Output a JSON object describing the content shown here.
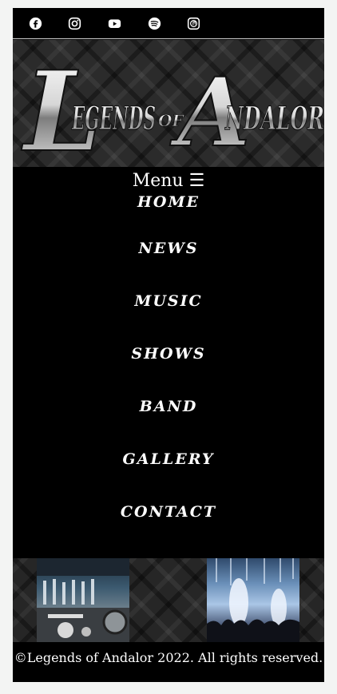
{
  "social": {
    "icons": [
      "facebook-icon",
      "instagram-icon",
      "youtube-icon",
      "spotify-icon",
      "itunes-icon"
    ]
  },
  "banner": {
    "logo_text": "Legends of Andalor",
    "logo_cap1": "L",
    "logo_word1": "EGENDS",
    "logo_of": "OF",
    "logo_cap2": "A",
    "logo_word2": "NDALOR"
  },
  "menu": {
    "toggle_label": "Menu ☰",
    "items": [
      {
        "label": "HOME"
      },
      {
        "label": "NEWS"
      },
      {
        "label": "MUSIC"
      },
      {
        "label": "SHOWS"
      },
      {
        "label": "BAND"
      },
      {
        "label": "GALLERY"
      },
      {
        "label": "CONTACT"
      }
    ]
  },
  "footer": {
    "copyright": "©Legends of Andalor 2022. All rights reserved."
  },
  "colors": {
    "background": "#000000",
    "page": "#f3f4f3",
    "text": "#ffffff"
  }
}
